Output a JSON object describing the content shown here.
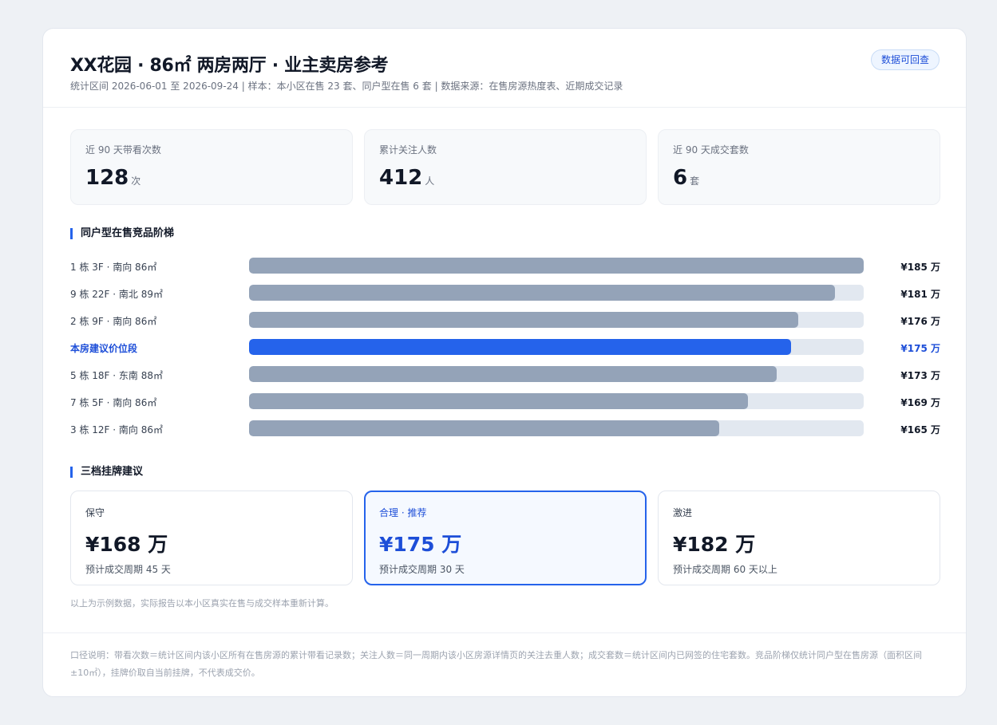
{
  "header": {
    "title": "XX花园 · 86㎡ 两房两厅 · 业主卖房参考",
    "subtitle": "统计区间 2026-06-01 至 2026-09-24  |  样本：本小区在售 23 套、同户型在售 6 套  |  数据来源：在售房源热度表、近期成交记录",
    "badge": "数据可回查"
  },
  "stats": [
    {
      "label": "近 90 天带看次数",
      "value": "128",
      "unit": "次"
    },
    {
      "label": "累计关注人数",
      "value": "412",
      "unit": "人"
    },
    {
      "label": "近 90 天成交套数",
      "value": "6",
      "unit": "套"
    }
  ],
  "ladder_section": {
    "title": "同户型在售竞品阶梯",
    "rows": [
      {
        "label": "1 栋 3F · 南向 86㎡",
        "price": "¥185 万",
        "value": 185,
        "highlight": false
      },
      {
        "label": "9 栋 22F · 南北 89㎡",
        "price": "¥181 万",
        "value": 181,
        "highlight": false
      },
      {
        "label": "2 栋 9F · 南向 86㎡",
        "price": "¥176 万",
        "value": 176,
        "highlight": false
      },
      {
        "label": "本房建议价位段",
        "price": "¥175 万",
        "value": 175,
        "highlight": true
      },
      {
        "label": "5 栋 18F · 东南 88㎡",
        "price": "¥173 万",
        "value": 173,
        "highlight": false
      },
      {
        "label": "7 栋 5F · 南向 86㎡",
        "price": "¥169 万",
        "value": 169,
        "highlight": false
      },
      {
        "label": "3 栋 12F · 南向 86㎡",
        "price": "¥165 万",
        "value": 165,
        "highlight": false
      }
    ],
    "scale_min": 100,
    "scale_max": 185
  },
  "tiers_section": {
    "title": "三档挂牌建议",
    "tiers": [
      {
        "name": "保守",
        "price": "¥168 万",
        "cycle": "预计成交周期 45 天",
        "recommended": false
      },
      {
        "name": "合理 · 推荐",
        "price": "¥175 万",
        "cycle": "预计成交周期 30 天",
        "recommended": true
      },
      {
        "name": "激进",
        "price": "¥182 万",
        "cycle": "预计成交周期 60 天以上",
        "recommended": false
      }
    ]
  },
  "note": "以上为示例数据，实际报告以本小区真实在售与成交样本重新计算。",
  "footer": "口径说明：带看次数＝统计区间内该小区所有在售房源的累计带看记录数；关注人数＝同一周期内该小区房源详情页的关注去重人数；成交套数＝统计区间内已网签的住宅套数。竞品阶梯仅统计同户型在售房源（面积区间 ±10㎡），挂牌价取自当前挂牌，不代表成交价。",
  "colors": {
    "accent": "#2563eb",
    "bar": "#94a3b8",
    "track": "#e2e8f0"
  }
}
